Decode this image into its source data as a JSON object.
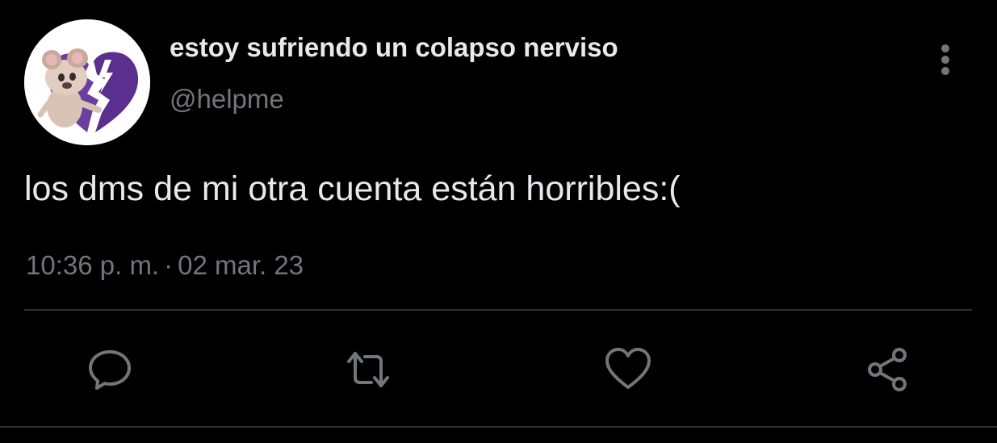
{
  "tweet": {
    "author": {
      "display_name": "estoy sufriendo un colapso nerviso",
      "handle": "@helpme",
      "avatar": "cartoon-mouse-broken-heart-avatar"
    },
    "text": "los dms de mi otra cuenta están horribles:(",
    "time": "10:36 p. m.",
    "separator": "·",
    "date": "02 mar. 23"
  },
  "icons": {
    "more": "more-vertical-icon",
    "reply": "reply-icon",
    "retweet": "retweet-icon",
    "like": "heart-icon",
    "share": "share-icon"
  },
  "colors": {
    "background": "#000000",
    "primary_text": "#e7e9ea",
    "secondary_text": "#71767b",
    "icon": "#71767b",
    "divider": "#2f3336",
    "avatar_heart": "#6b3fa0"
  }
}
